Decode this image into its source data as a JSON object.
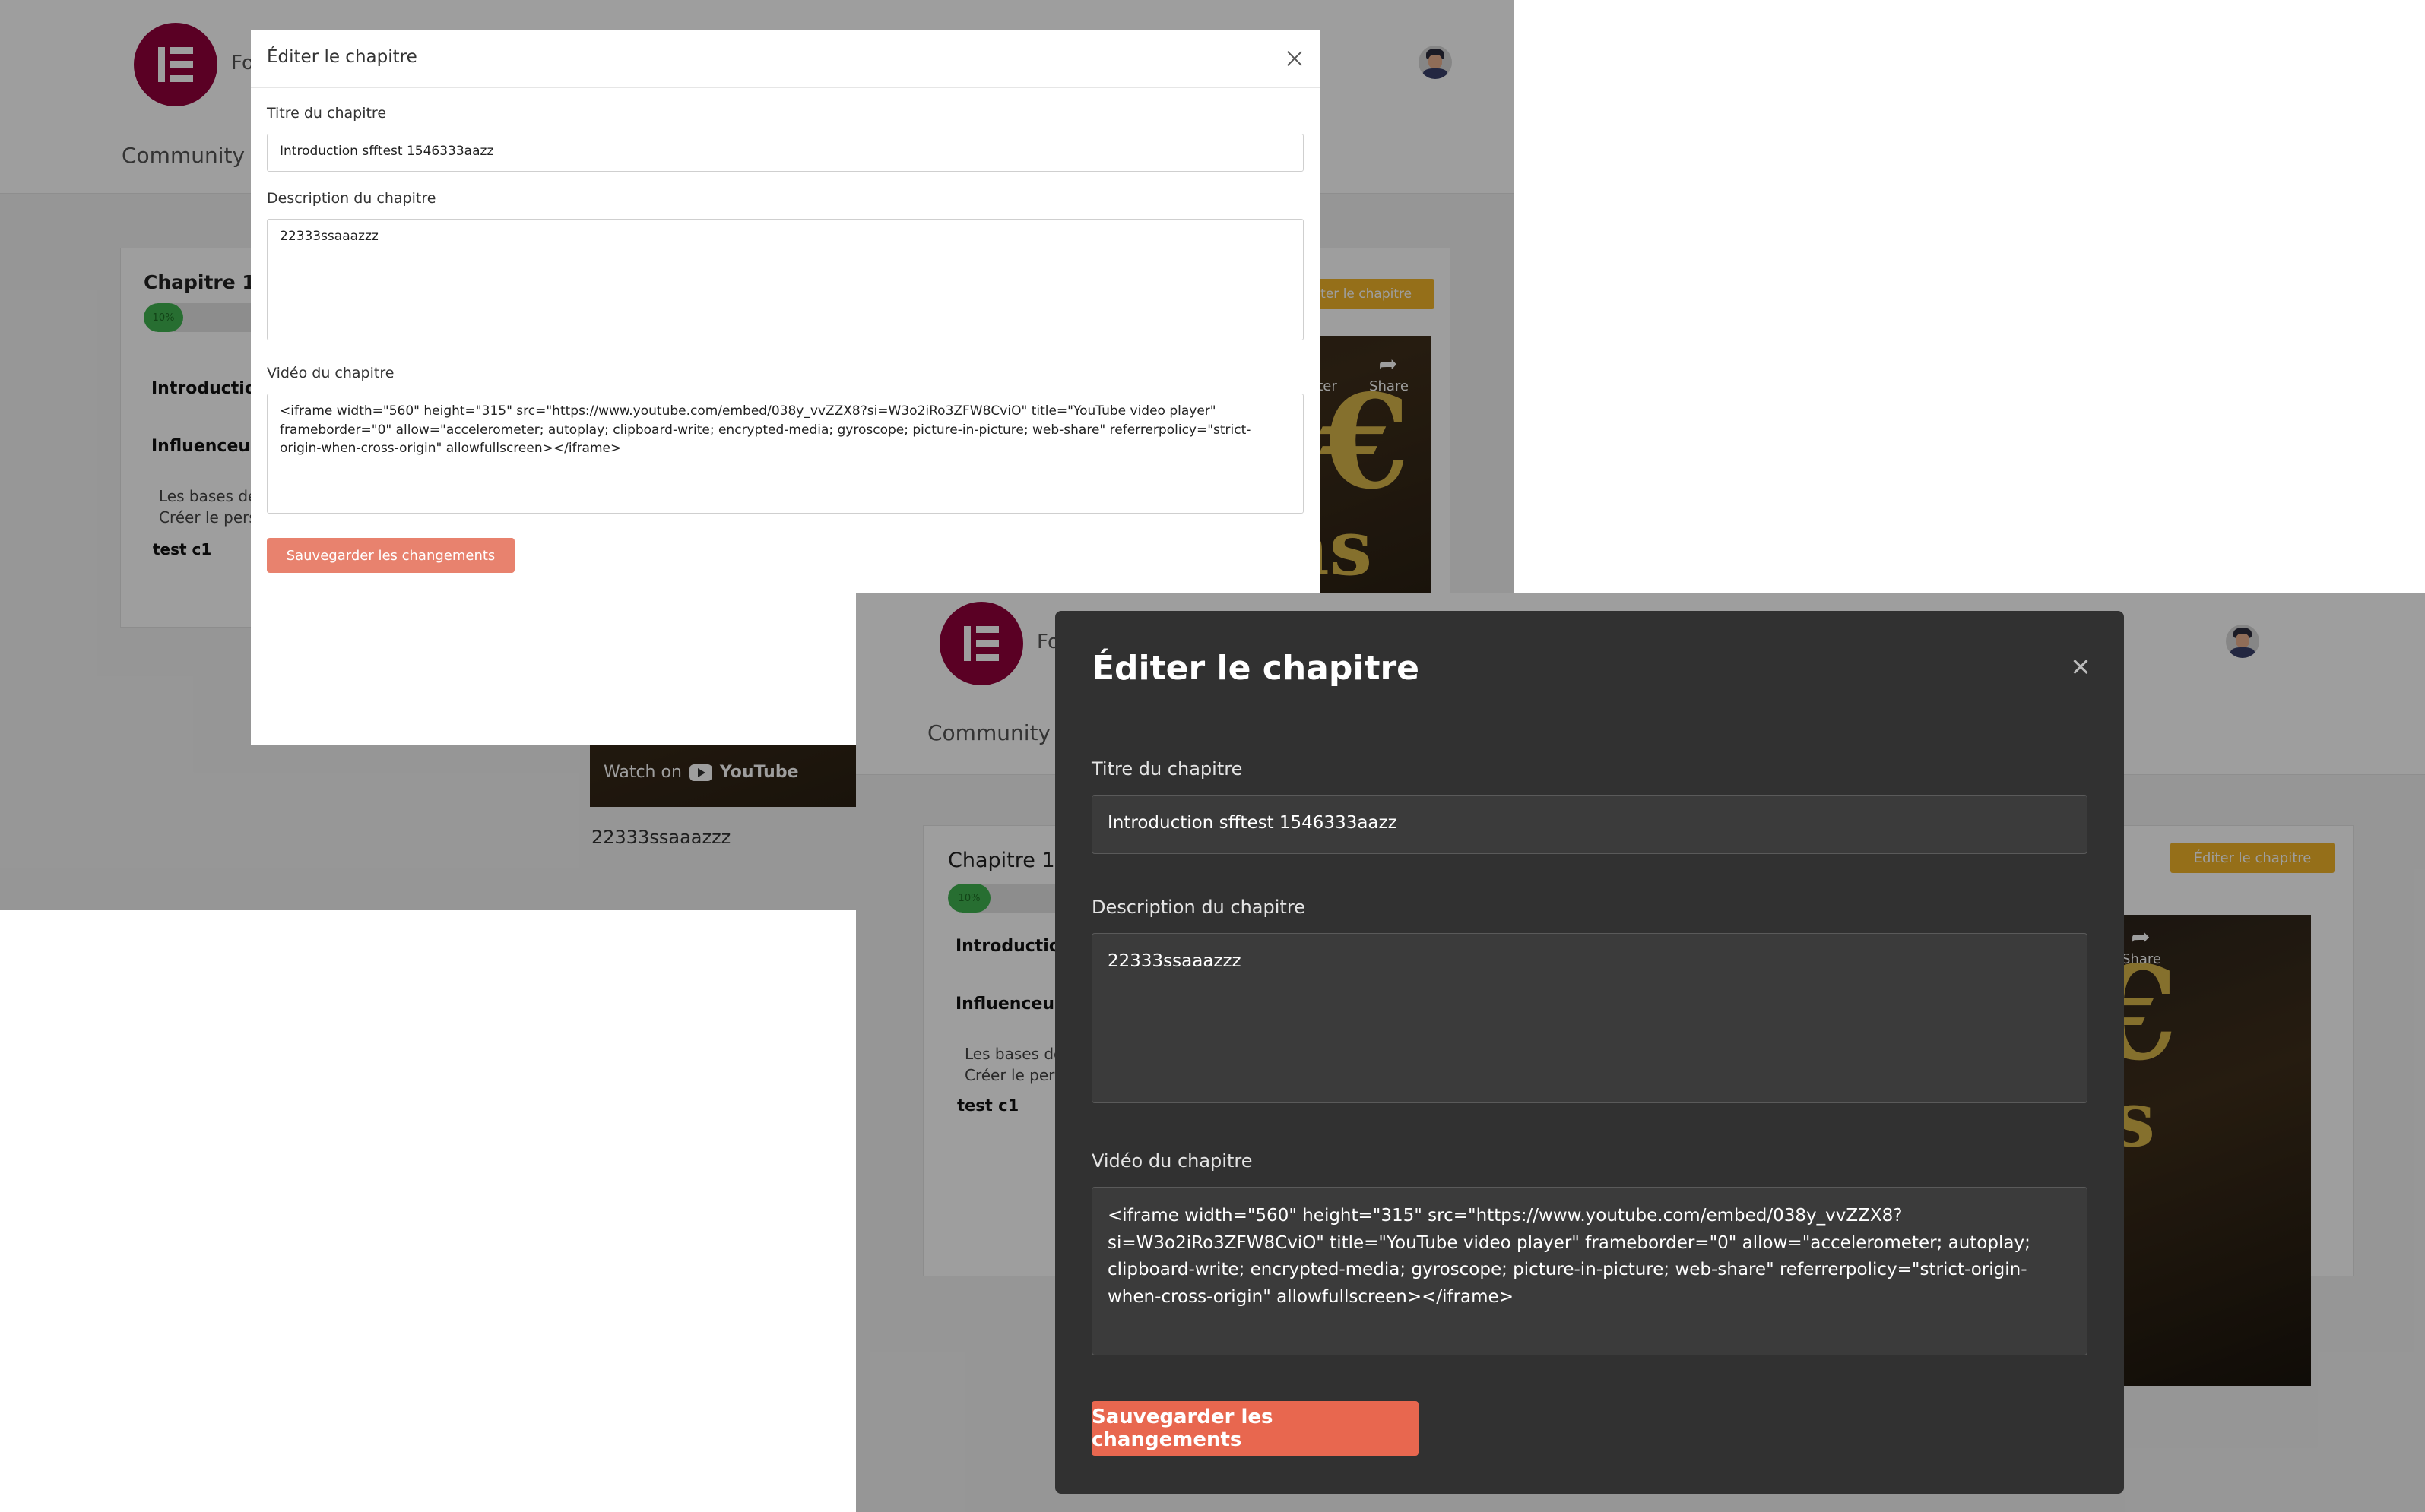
{
  "app": {
    "brand_letter": "E",
    "brand_name_fragment": "Fo",
    "nav_community": "Community"
  },
  "background_page": {
    "chapter_heading": "Chapitre 1 :",
    "progress_percent": 10,
    "progress_label": "10%",
    "lessons": [
      "Introduction",
      "Influenceus"
    ],
    "sublessons": [
      "Les bases de",
      "Créer le pers"
    ],
    "extra_lesson": "test c1",
    "edit_chapter_button": "Éditer le chapitre",
    "video_share_label": "Share",
    "video_watch_later_fragment": "ter",
    "video_watch_on": "Watch on",
    "video_platform": "YouTube",
    "video_glyph_euro": "€",
    "video_glyph_ns": "ns",
    "chapter_description_preview": "22333ssaaazzz"
  },
  "modal_light": {
    "title": "Éditer le chapitre",
    "title_label": "Titre du chapitre",
    "title_value": "Introduction sfftest 1546333aazz",
    "description_label": "Description du chapitre",
    "description_value": "22333ssaaazzz",
    "video_label": "Vidéo du chapitre",
    "video_value": "<iframe width=\"560\" height=\"315\" src=\"https://www.youtube.com/embed/038y_vvZZX8?si=W3o2iRo3ZFW8CviO\" title=\"YouTube video player\" frameborder=\"0\" allow=\"accelerometer; autoplay; clipboard-write; encrypted-media; gyroscope; picture-in-picture; web-share\" referrerpolicy=\"strict-origin-when-cross-origin\" allowfullscreen></iframe>",
    "save_button": "Sauvegarder les changements"
  },
  "modal_dark": {
    "title": "Éditer le chapitre",
    "title_label": "Titre du chapitre",
    "title_value": "Introduction sfftest 1546333aazz",
    "description_label": "Description du chapitre",
    "description_value": "22333ssaaazzz",
    "video_label": "Vidéo du chapitre",
    "video_value": "<iframe width=\"560\" height=\"315\" src=\"https://www.youtube.com/embed/038y_vvZZX8?si=W3o2iRo3ZFW8CviO\" title=\"YouTube video player\" frameborder=\"0\" allow=\"accelerometer; autoplay; clipboard-write; encrypted-media; gyroscope; picture-in-picture; web-share\" referrerpolicy=\"strict-origin-when-cross-origin\" allowfullscreen></iframe>",
    "save_button": "Sauvegarder les changements"
  },
  "colors": {
    "brand": "#92003b",
    "accent_save_light": "#e8826e",
    "accent_save_dark": "#e8674f",
    "edit_pill": "#f0b429",
    "progress_fill": "#3fb24f",
    "dark_modal_bg": "#313131"
  },
  "icons": [
    "close-icon",
    "share-icon",
    "youtube-logo-icon",
    "avatar"
  ]
}
